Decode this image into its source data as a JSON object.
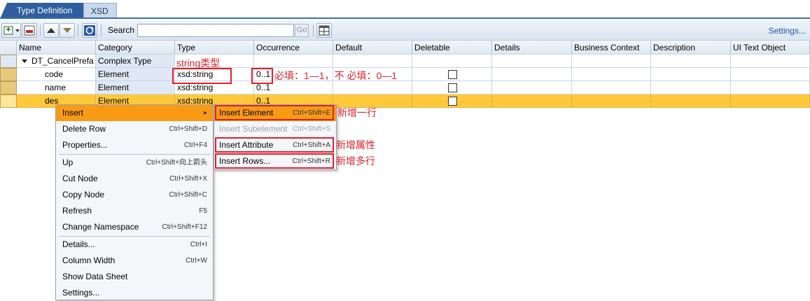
{
  "tabs": {
    "type_definition": "Type Definition",
    "xsd": "XSD"
  },
  "toolbar": {
    "search_label": "Search",
    "search_value": "",
    "go_label": "Go",
    "settings_label": "Settings..."
  },
  "columns": [
    "Name",
    "Category",
    "Type",
    "Occurrence",
    "Default",
    "Deletable",
    "Details",
    "Business Context",
    "Description",
    "UI Text Object"
  ],
  "rows": [
    {
      "name": "DT_CancelPrefa",
      "category": "Complex Type",
      "type": "",
      "occurrence": ""
    },
    {
      "name": "code",
      "category": "Element",
      "type": "xsd:string",
      "occurrence": "0..1"
    },
    {
      "name": "name",
      "category": "Element",
      "type": "xsd:string",
      "occurrence": "0..1"
    },
    {
      "name": "des",
      "category": "Element",
      "type": "xsd:string",
      "occurrence": "0..1"
    }
  ],
  "annotations": {
    "string_type": "string类型",
    "occurrence_note": "必填：1—1，不 必填：0—1",
    "new_row": "新增一行",
    "new_attribute": "新增属性",
    "new_rows": "新增多行"
  },
  "context_menu": {
    "items": [
      {
        "label": "Insert",
        "shortcut": "▸"
      },
      {
        "label": "Delete Row",
        "shortcut": "Ctrl+Shift+D"
      },
      {
        "label": "Properties...",
        "shortcut": "Ctrl+F4"
      },
      {
        "label": "Up",
        "shortcut": "Ctrl+Shift+向上箭头"
      },
      {
        "label": "Cut Node",
        "shortcut": "Ctrl+Shift+X"
      },
      {
        "label": "Copy Node",
        "shortcut": "Ctrl+Shift+C"
      },
      {
        "label": "Refresh",
        "shortcut": "F5"
      },
      {
        "label": "Change Namespace",
        "shortcut": "Ctrl+Shift+F12"
      },
      {
        "label": "Details...",
        "shortcut": "Ctrl+I"
      },
      {
        "label": "Column Width",
        "shortcut": "Ctrl+W"
      },
      {
        "label": "Show Data Sheet",
        "shortcut": ""
      },
      {
        "label": "Settings...",
        "shortcut": ""
      }
    ]
  },
  "submenu": {
    "items": [
      {
        "label": "Insert Element",
        "shortcut": "Ctrl+Shift+E"
      },
      {
        "label": "Insert Subelement",
        "shortcut": "Ctrl+Shift+S"
      },
      {
        "label": "Insert Attribute",
        "shortcut": "Ctrl+Shift+A"
      },
      {
        "label": "Insert Rows...",
        "shortcut": "Ctrl+Shift+R"
      }
    ]
  },
  "colors": {
    "accent": "#2f5f9e",
    "selected_row": "#ffc93c",
    "menu_highlight": "#f99a14",
    "annotation": "#e0202a"
  }
}
